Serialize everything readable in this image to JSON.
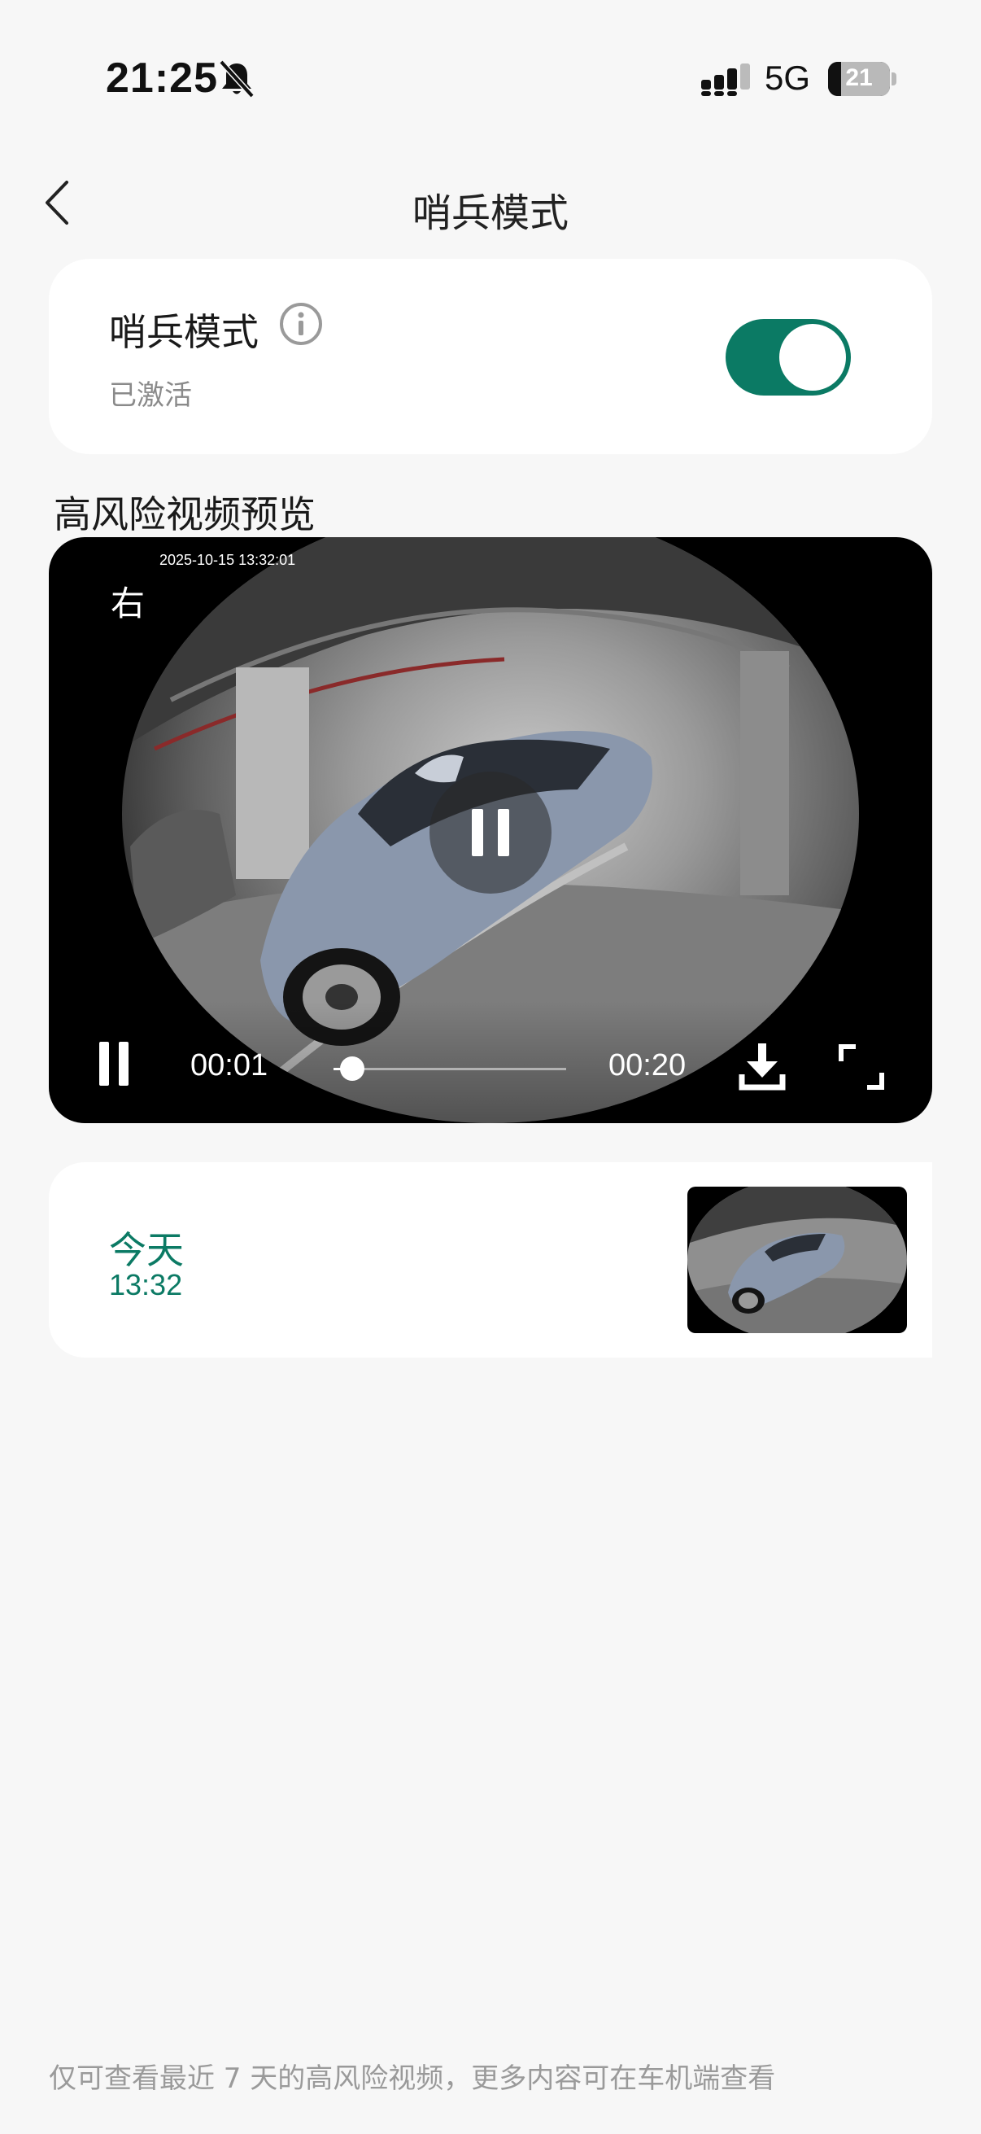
{
  "status_bar": {
    "time": "21:25",
    "network": "5G",
    "battery_level": "21"
  },
  "nav": {
    "title": "哨兵模式"
  },
  "sentry_card": {
    "title": "哨兵模式",
    "status": "已激活",
    "enabled": true
  },
  "preview": {
    "heading": "高风险视频预览",
    "timestamp": "2025-10-15 13:32:01",
    "camera_label": "右",
    "time_current": "00:01",
    "time_total": "00:20",
    "progress": 0.05
  },
  "clips": [
    {
      "day": "今天",
      "time": "13:32"
    }
  ],
  "footer": {
    "note": "仅可查看最近 7 天的高风险视频，更多内容可在车机端查看"
  },
  "colors": {
    "accent": "#0b7a64",
    "background": "#f7f7f7"
  }
}
